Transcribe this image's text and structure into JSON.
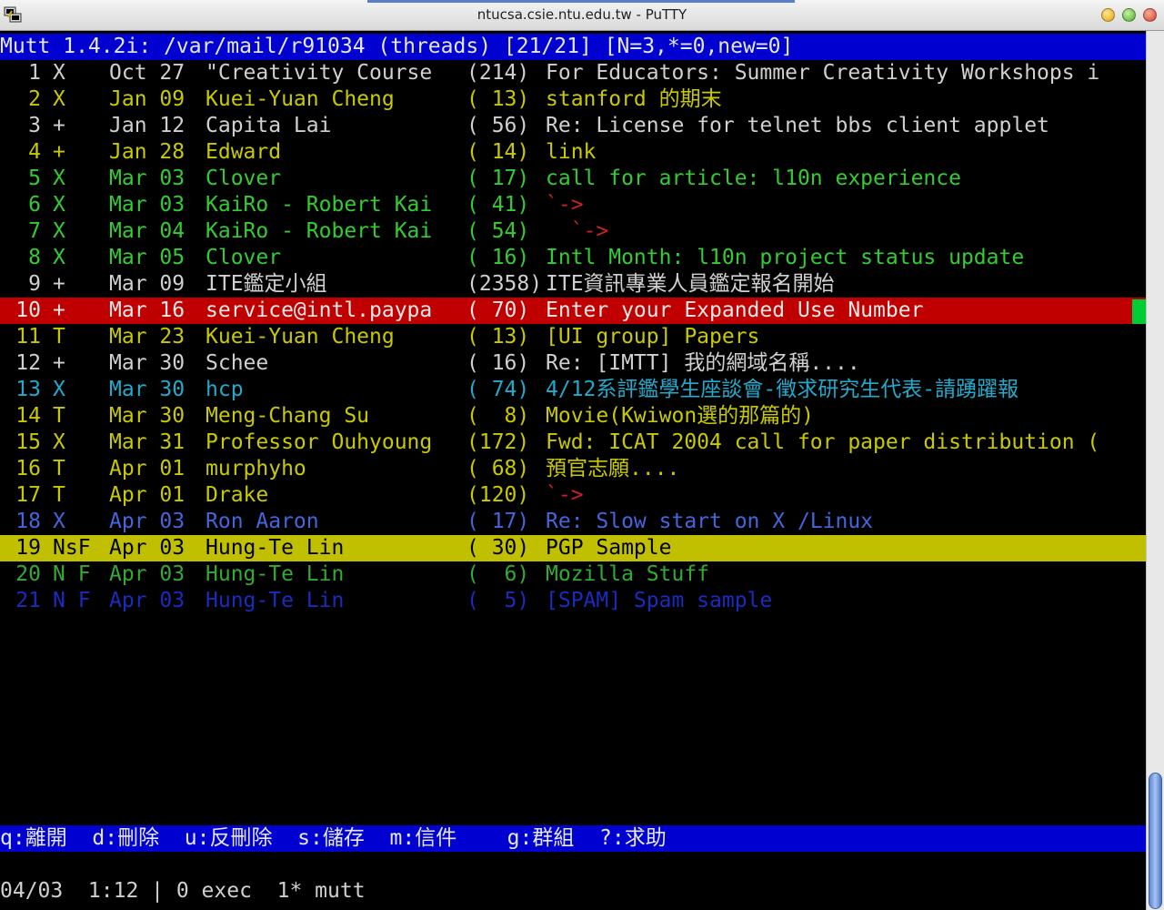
{
  "window": {
    "title": "ntucsa.csie.ntu.edu.tw - PuTTY",
    "buttons": [
      "minimize",
      "maximize",
      "close"
    ]
  },
  "mutt": {
    "header": "Mutt 1.4.2i: /var/mail/r91034 (threads) [21/21] [N=3,*=0,new=0]",
    "messages": [
      {
        "num": "1",
        "flag": "X",
        "date": "Oct 27",
        "from": "\"Creativity Course",
        "size": "(214)",
        "subject": "For Educators: Summer Creativity Workshops i",
        "color": "#d0d0d0"
      },
      {
        "num": "2",
        "flag": "X",
        "date": "Jan 09",
        "from": "Kuei-Yuan Cheng",
        "size": "( 13)",
        "subject": "stanford 的期末",
        "color": "#c9c900"
      },
      {
        "num": "3",
        "flag": "+",
        "date": "Jan 12",
        "from": "Capita Lai",
        "size": "( 56)",
        "subject": "Re: License for telnet bbs client applet",
        "color": "#d0d0d0"
      },
      {
        "num": "4",
        "flag": "+",
        "date": "Jan 28",
        "from": "Edward",
        "size": "( 14)",
        "subject": "link",
        "color": "#c9c900"
      },
      {
        "num": "5",
        "flag": "X",
        "date": "Mar 03",
        "from": "Clover",
        "size": "( 17)",
        "subject": "call for article: l10n experience",
        "color": "#33cc33"
      },
      {
        "num": "6",
        "flag": "X",
        "date": "Mar 03",
        "from": "KaiRo - Robert Kai",
        "size": "( 41)",
        "subject": "`->",
        "color": "#33cc33",
        "subject_color": "#cc2222"
      },
      {
        "num": "7",
        "flag": "X",
        "date": "Mar 04",
        "from": "KaiRo - Robert Kai",
        "size": "( 54)",
        "subject": "  `->",
        "color": "#33cc33",
        "subject_color": "#cc2222"
      },
      {
        "num": "8",
        "flag": "X",
        "date": "Mar 05",
        "from": "Clover",
        "size": "( 16)",
        "subject": "Intl Month: l10n project status update",
        "color": "#33cc33"
      },
      {
        "num": "9",
        "flag": "+",
        "date": "Mar 09",
        "from": "ITE鑑定小組",
        "size": "(2358)",
        "subject": "ITE資訊專業人員鑑定報名開始",
        "color": "#d0d0d0"
      },
      {
        "num": "10",
        "flag": "+",
        "date": "Mar 16",
        "from": "service@intl.paypa",
        "size": "( 70)",
        "subject": "Enter your Expanded Use Number",
        "color": "#e8e8e8",
        "bg": "#c00000"
      },
      {
        "num": "11",
        "flag": "T",
        "date": "Mar 23",
        "from": "Kuei-Yuan Cheng",
        "size": "( 13)",
        "subject": "[UI group] Papers",
        "color": "#c9c900"
      },
      {
        "num": "12",
        "flag": "+",
        "date": "Mar 30",
        "from": "Schee",
        "size": "( 16)",
        "subject": "Re: [IMTT] 我的網域名稱....",
        "color": "#d0d0d0"
      },
      {
        "num": "13",
        "flag": "X",
        "date": "Mar 30",
        "from": "hcp",
        "size": "( 74)",
        "subject": "4/12系評鑑學生座談會-徵求研究生代表-請踴躍報",
        "color": "#22aacc"
      },
      {
        "num": "14",
        "flag": "T",
        "date": "Mar 30",
        "from": "Meng-Chang Su",
        "size": "(  8)",
        "subject": "Movie(Kwiwon選的那篇的)",
        "color": "#c9c900"
      },
      {
        "num": "15",
        "flag": "X",
        "date": "Mar 31",
        "from": "Professor Ouhyoung",
        "size": "(172)",
        "subject": "Fwd: ICAT 2004 call for paper distribution (",
        "color": "#c9c900"
      },
      {
        "num": "16",
        "flag": "T",
        "date": "Apr 01",
        "from": "murphyho",
        "size": "( 68)",
        "subject": "預官志願....",
        "color": "#c9c900"
      },
      {
        "num": "17",
        "flag": "T",
        "date": "Apr 01",
        "from": "Drake",
        "size": "(120)",
        "subject": "`->",
        "color": "#c9c900",
        "subject_color": "#cc2222"
      },
      {
        "num": "18",
        "flag": "X",
        "date": "Apr 03",
        "from": "Ron Aaron",
        "size": "( 17)",
        "subject": "Re: Slow start on X /Linux",
        "color": "#4466dd"
      },
      {
        "num": "19",
        "flag": "NsF",
        "date": "Apr 03",
        "from": "Hung-Te Lin",
        "size": "( 30)",
        "subject": "PGP Sample",
        "color": "#000000",
        "bg": "#c0c000"
      },
      {
        "num": "20",
        "flag": "N F",
        "date": "Apr 03",
        "from": "Hung-Te Lin",
        "size": "(  6)",
        "subject": "Mozilla Stuff",
        "color": "#33aa33"
      },
      {
        "num": "21",
        "flag": "N F",
        "date": "Apr 03",
        "from": "Hung-Te Lin",
        "size": "(  5)",
        "subject": "[SPAM] Spam sample",
        "color": "#1a2cc0"
      }
    ],
    "help_bar": "q:離開  d:刪除  u:反刪除  s:儲存  m:信件    g:群組  ?:求助"
  },
  "screen_status": "04/03  1:12 | 0 exec  1* mutt"
}
